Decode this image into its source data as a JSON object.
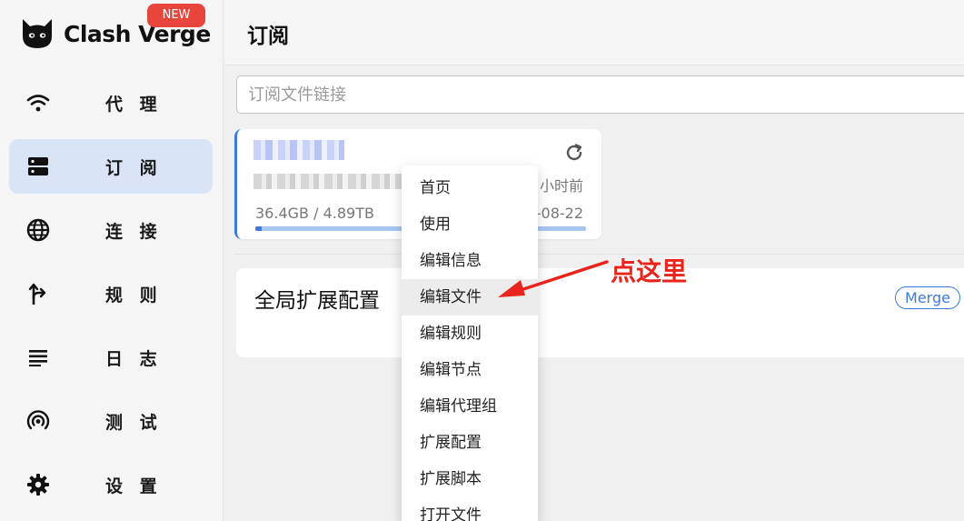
{
  "app": {
    "name": "Clash Verge",
    "new_badge": "NEW"
  },
  "sidebar": {
    "items": [
      {
        "label": "代 理",
        "icon": "wifi-icon",
        "active": false
      },
      {
        "label": "订 阅",
        "icon": "server-icon",
        "active": true
      },
      {
        "label": "连 接",
        "icon": "globe-icon",
        "active": false
      },
      {
        "label": "规 则",
        "icon": "fork-arrow-icon",
        "active": false
      },
      {
        "label": "日 志",
        "icon": "lines-icon",
        "active": false
      },
      {
        "label": "测 试",
        "icon": "radar-icon",
        "active": false
      },
      {
        "label": "设 置",
        "icon": "gear-icon",
        "active": false
      }
    ]
  },
  "header": {
    "title": "订阅"
  },
  "search": {
    "placeholder": "订阅文件链接"
  },
  "subscription": {
    "updated": "小时前",
    "usage": "36.4GB / 4.89TB",
    "expire": "-08-22",
    "progress": 0.02
  },
  "merge": {
    "title": "全局扩展配置",
    "badge": "Merge"
  },
  "context_menu": {
    "items": [
      "首页",
      "使用",
      "编辑信息",
      "编辑文件",
      "编辑规则",
      "编辑节点",
      "编辑代理组",
      "扩展配置",
      "扩展脚本",
      "打开文件"
    ],
    "highlighted_index": 3
  },
  "annotation": {
    "text": "点这里"
  },
  "colors": {
    "accent": "#3d7ae0",
    "active_nav": "#d9e4f6",
    "badge_red": "#e8453c",
    "annotation_red": "#e8241c"
  }
}
